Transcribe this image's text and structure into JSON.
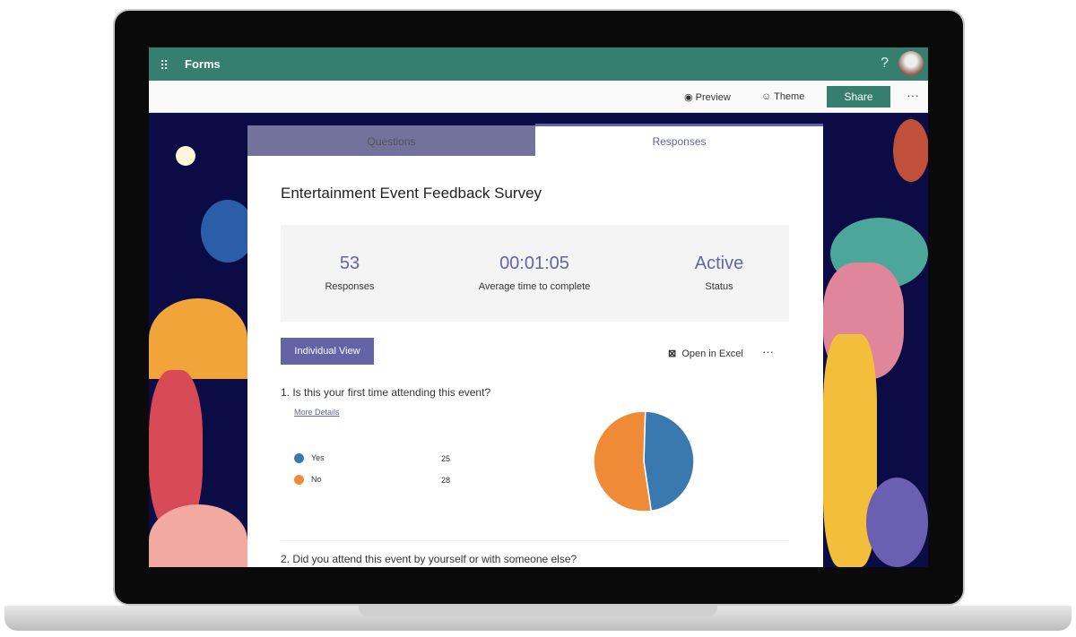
{
  "app": {
    "name": "Forms",
    "help": "?"
  },
  "commands": {
    "preview": "Preview",
    "theme": "Theme",
    "share": "Share",
    "more": "···"
  },
  "tabs": [
    {
      "label": "Questions"
    },
    {
      "label": "Responses"
    }
  ],
  "form": {
    "title": "Entertainment Event Feedback Survey"
  },
  "stats": [
    {
      "value": "53",
      "label": "Responses"
    },
    {
      "value": "00:01:05",
      "label": "Average time to complete"
    },
    {
      "value": "Active",
      "label": "Status"
    }
  ],
  "actions": {
    "individual_view": "Individual  View",
    "open_excel": "Open in Excel",
    "more": "···"
  },
  "questions": [
    {
      "text": "1.  Is this your first time attending this event?",
      "more_details": "More Details"
    },
    {
      "text": "2.  Did you attend this event by yourself or with someone else?"
    }
  ],
  "chart_data": {
    "type": "pie",
    "categories": [
      "Yes",
      "No"
    ],
    "values": [
      25,
      28
    ],
    "colors": [
      "#3a78b0",
      "#ef8a36"
    ]
  },
  "colors": {
    "brand": "#367f6f",
    "accent": "#6264a7"
  }
}
